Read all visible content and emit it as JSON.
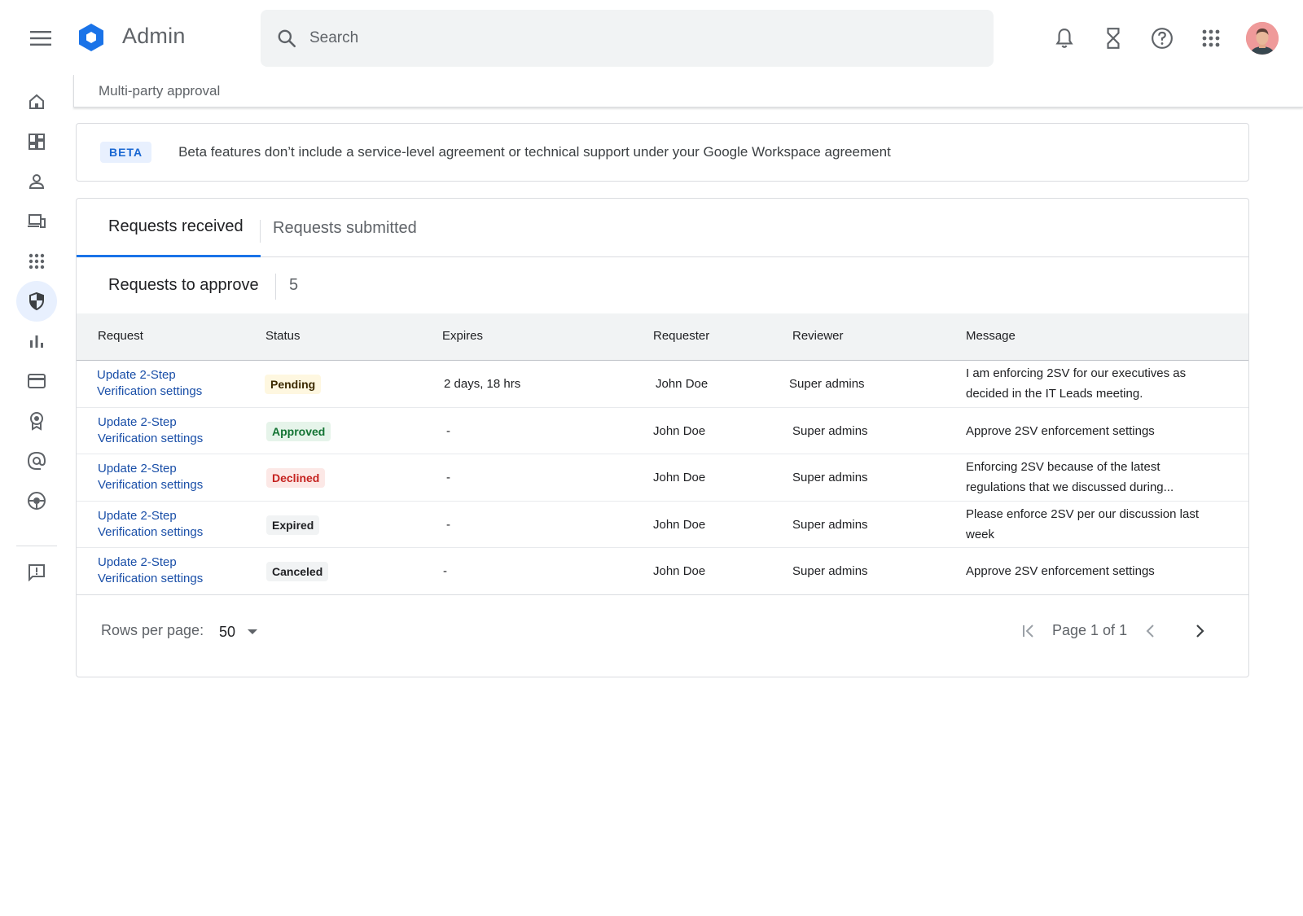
{
  "header": {
    "app_title": "Admin",
    "search_placeholder": "Search"
  },
  "breadcrumb": {
    "current": "Multi-party approval"
  },
  "beta_banner": {
    "badge": "BETA",
    "text": "Beta features don’t include a service-level agreement or technical support under your Google Workspace agreement"
  },
  "tabs": [
    {
      "label": "Requests received",
      "active": true
    },
    {
      "label": "Requests submitted",
      "active": false
    }
  ],
  "section": {
    "title": "Requests to approve",
    "count": "5"
  },
  "table": {
    "columns": [
      "Request",
      "Status",
      "Expires",
      "Requester",
      "Reviewer",
      "Message"
    ],
    "rows": [
      {
        "request_line1": "Update 2-Step",
        "request_line2": "Verification settings",
        "status": "Pending",
        "expires": "2 days, 18 hrs",
        "requester": "John Doe",
        "reviewer": "Super admins",
        "message": "I am enforcing 2SV for our executives as decided in the IT Leads meeting."
      },
      {
        "request_line1": "Update 2-Step",
        "request_line2": "Verification settings",
        "status": "Approved",
        "expires": "-",
        "requester": "John Doe",
        "reviewer": "Super admins",
        "message": "Approve 2SV enforcement settings"
      },
      {
        "request_line1": "Update 2-Step",
        "request_line2": "Verification settings",
        "status": "Declined",
        "expires": "-",
        "requester": "John Doe",
        "reviewer": "Super admins",
        "message": "Enforcing 2SV because of the latest regulations that we discussed during..."
      },
      {
        "request_line1": "Update 2-Step",
        "request_line2": "Verification settings",
        "status": "Expired",
        "expires": "-",
        "requester": "John Doe",
        "reviewer": "Super admins",
        "message": "Please enforce 2SV per our discussion last week"
      },
      {
        "request_line1": "Update 2-Step",
        "request_line2": "Verification settings",
        "status": "Canceled",
        "expires": "-",
        "requester": "John Doe",
        "reviewer": "Super admins",
        "message": "Approve 2SV enforcement settings"
      }
    ]
  },
  "pagination": {
    "rows_per_page_label": "Rows per page:",
    "rows_per_page_value": "50",
    "page_label": "Page 1 of 1"
  },
  "icons": {
    "top": [
      "notifications-icon",
      "hourglass-icon",
      "help-icon",
      "apps-grid-icon"
    ],
    "rail": [
      "home-icon",
      "dashboard-icon",
      "user-icon",
      "devices-icon",
      "apps-icon",
      "security-shield-icon",
      "reports-icon",
      "billing-icon",
      "rules-icon",
      "email-icon",
      "account-icon",
      "feedback-icon"
    ]
  },
  "colors": {
    "accent": "#1a73e8",
    "link": "#1a4fa8",
    "logo": "#1a73e8"
  }
}
